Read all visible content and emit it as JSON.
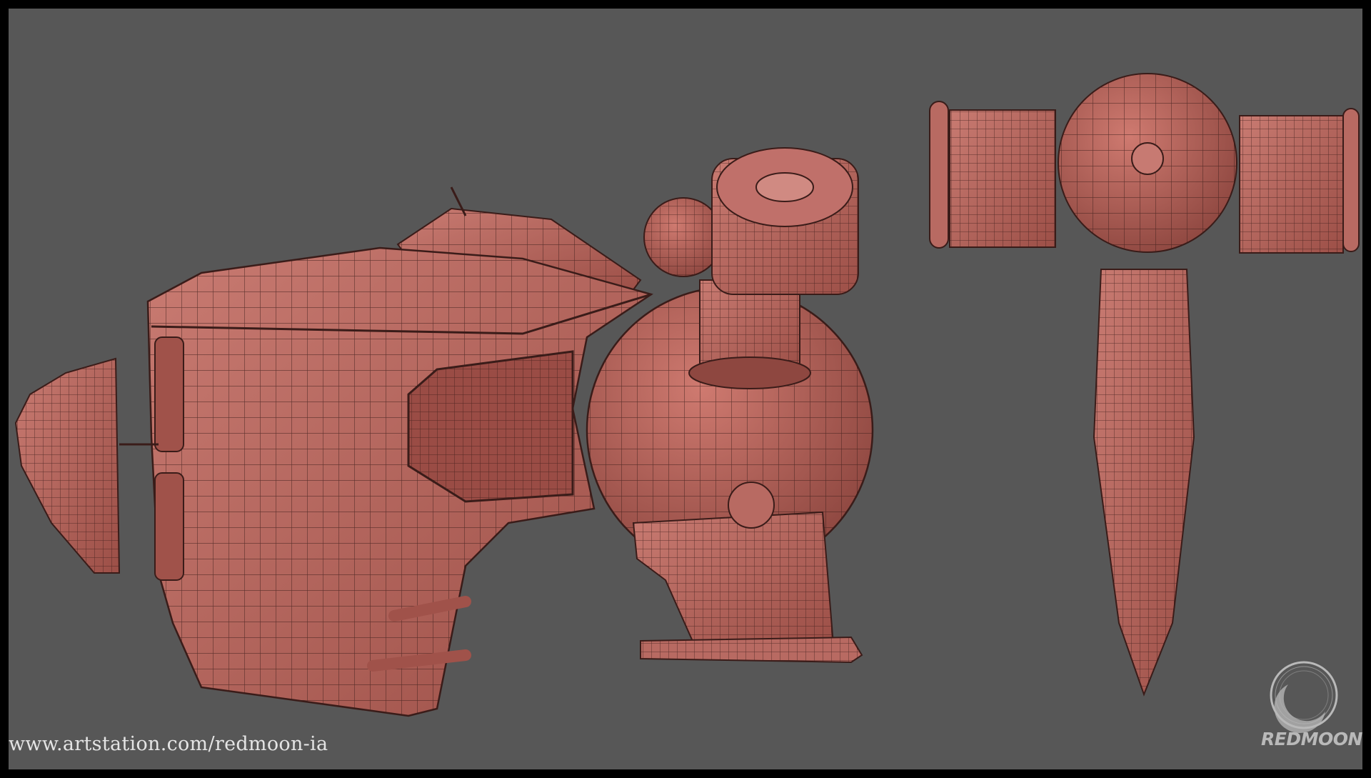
{
  "watermark": {
    "url": "www.artstation.com/redmoon-ia",
    "brand": "REDMOON"
  },
  "icons": {
    "logo": "crescent-moon-logo-icon"
  },
  "colors": {
    "background": "#575757",
    "frame": "#000000",
    "model": "#b45f57",
    "wireframe": "#3a1c19"
  }
}
